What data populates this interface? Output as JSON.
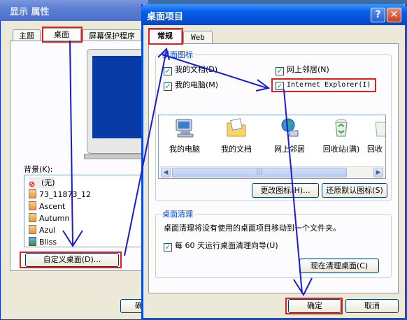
{
  "back_window": {
    "title": "显示 属性",
    "tabs": [
      "主题",
      "桌面",
      "屏幕保护程序"
    ],
    "background_label": "背景(K):",
    "background_items": [
      "(无)",
      "73_11873_12",
      "Ascent",
      "Autumn",
      "Azul",
      "Bliss"
    ],
    "customize_button": "自定义桌面(D)...",
    "ok_partial": "确"
  },
  "dialog": {
    "title": "桌面项目",
    "help_glyph": "?",
    "close_glyph": "✕",
    "tabs": [
      "常规",
      "Web"
    ],
    "desktop_icons": {
      "group_title": "桌面图标",
      "checkboxes": [
        {
          "label": "我的文档(D)",
          "checked": true
        },
        {
          "label": "网上邻居(N)",
          "checked": true
        },
        {
          "label": "我的电脑(M)",
          "checked": true
        },
        {
          "label": "Internet Explorer(I)",
          "checked": true
        }
      ],
      "icons": [
        "我的电脑",
        "我的文档",
        "网上邻居",
        "回收站(满)",
        "回收"
      ],
      "change_icon_button": "更改图标(H)...",
      "restore_default_button": "还原默认图标(S)"
    },
    "cleanup": {
      "group_title": "桌面清理",
      "description": "桌面清理将没有使用的桌面项目移动到一个文件夹。",
      "checkbox_label": "每 60 天运行桌面清理向导(U)",
      "checkbox_checked": true,
      "clean_now_button": "现在清理桌面(C)"
    },
    "ok_button": "确定",
    "cancel_button": "取消"
  },
  "colors": {
    "highlight": "#e0201c",
    "arrow": "#1a1ad8",
    "title_blue": "#0a5fe8"
  }
}
